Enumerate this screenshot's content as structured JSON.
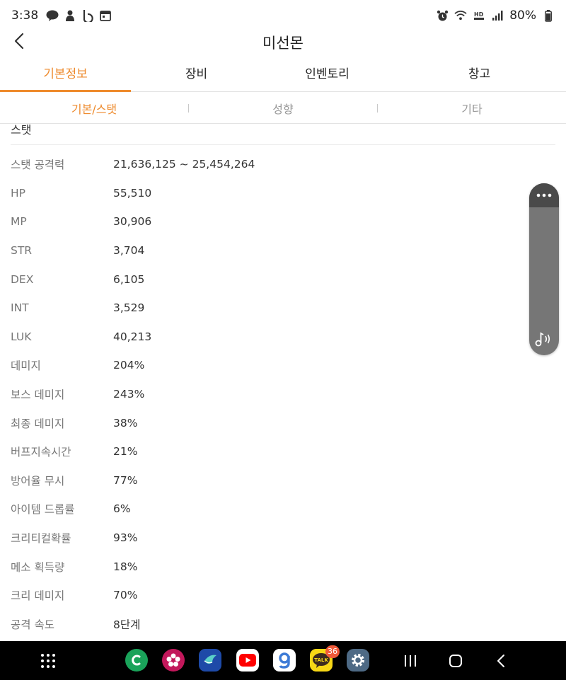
{
  "status_bar": {
    "time": "3:38",
    "battery": "80%"
  },
  "header": {
    "title": "미선몬"
  },
  "main_tabs": [
    {
      "label": "기본정보"
    },
    {
      "label": "장비"
    },
    {
      "label": "인벤토리"
    },
    {
      "label": "창고"
    }
  ],
  "sub_tabs": [
    {
      "label": "기본/스탯"
    },
    {
      "label": "성향"
    },
    {
      "label": "기타"
    }
  ],
  "section": {
    "title": "스탯"
  },
  "stats": [
    {
      "label": "스탯 공격력",
      "value": "21,636,125 ~ 25,454,264"
    },
    {
      "label": "HP",
      "value": "55,510"
    },
    {
      "label": "MP",
      "value": "30,906"
    },
    {
      "label": "STR",
      "value": "3,704"
    },
    {
      "label": "DEX",
      "value": "6,105"
    },
    {
      "label": "INT",
      "value": "3,529"
    },
    {
      "label": "LUK",
      "value": "40,213"
    },
    {
      "label": "데미지",
      "value": "204%"
    },
    {
      "label": "보스 데미지",
      "value": "243%"
    },
    {
      "label": "최종 데미지",
      "value": "38%"
    },
    {
      "label": "버프지속시간",
      "value": "21%"
    },
    {
      "label": "방어율 무시",
      "value": "77%"
    },
    {
      "label": "아이템 드롭률",
      "value": "6%"
    },
    {
      "label": "크리티컬확률",
      "value": "93%"
    },
    {
      "label": "메소 획득량",
      "value": "18%"
    },
    {
      "label": "크리 데미지",
      "value": "70%"
    },
    {
      "label": "공격 속도",
      "value": "8단계"
    }
  ],
  "nav": {
    "kakao_badge": "36"
  },
  "colors": {
    "accent": "#ee8a2c",
    "nav_background": "#000000"
  }
}
